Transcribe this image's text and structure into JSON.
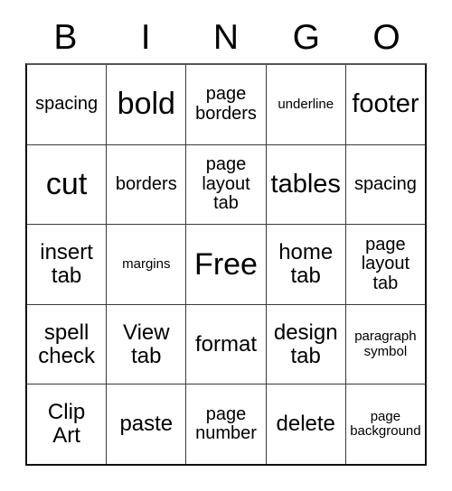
{
  "card": {
    "header": {
      "letters": [
        "B",
        "I",
        "N",
        "G",
        "O"
      ]
    },
    "rows": [
      [
        {
          "text": "spacing",
          "size": "sm"
        },
        {
          "text": "bold",
          "size": "xl"
        },
        {
          "text": "page\nborders",
          "size": "sm"
        },
        {
          "text": "underline",
          "size": "xs"
        },
        {
          "text": "footer",
          "size": "lg"
        }
      ],
      [
        {
          "text": "cut",
          "size": "xl"
        },
        {
          "text": "borders",
          "size": "sm"
        },
        {
          "text": "page\nlayout\ntab",
          "size": "sm"
        },
        {
          "text": "tables",
          "size": "lg"
        },
        {
          "text": "spacing",
          "size": "sm"
        }
      ],
      [
        {
          "text": "insert\ntab",
          "size": "md"
        },
        {
          "text": "margins",
          "size": "xs"
        },
        {
          "text": "Free",
          "size": "xl"
        },
        {
          "text": "home\ntab",
          "size": "md"
        },
        {
          "text": "page\nlayout\ntab",
          "size": "sm"
        }
      ],
      [
        {
          "text": "spell\ncheck",
          "size": "md"
        },
        {
          "text": "View\ntab",
          "size": "md"
        },
        {
          "text": "format",
          "size": "md"
        },
        {
          "text": "design\ntab",
          "size": "md"
        },
        {
          "text": "paragraph\nsymbol",
          "size": "xs"
        }
      ],
      [
        {
          "text": "Clip\nArt",
          "size": "md"
        },
        {
          "text": "paste",
          "size": "md"
        },
        {
          "text": "page\nnumber",
          "size": "sm"
        },
        {
          "text": "delete",
          "size": "md"
        },
        {
          "text": "page\nbackground",
          "size": "xs"
        }
      ]
    ]
  }
}
